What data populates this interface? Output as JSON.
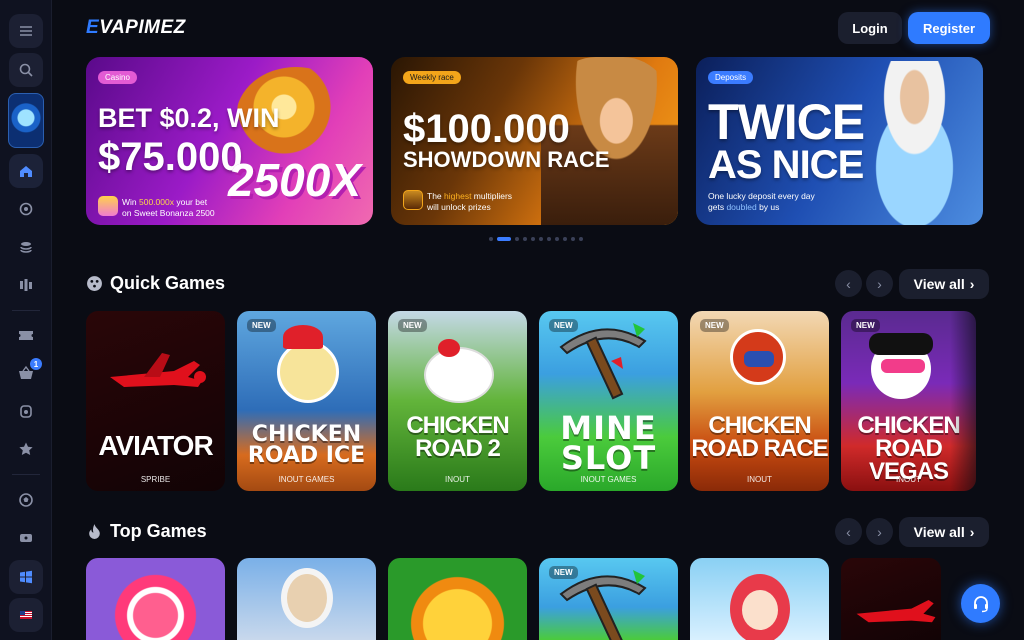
{
  "brand": {
    "logo_prefix": "E",
    "logo_rest": "VAPIMEZ",
    "accent": "#2f7bff"
  },
  "header": {
    "login": "Login",
    "register": "Register"
  },
  "sidebar": {
    "icons": [
      "menu-icon",
      "search-icon",
      "home-icon",
      "casino-chip-icon",
      "stack-icon",
      "live-games-icon",
      "ticket-icon",
      "basket-icon",
      "cup-icon",
      "star-icon",
      "sports-ball-icon",
      "sport-tickets-icon",
      "windows-icon",
      "flag-us-icon"
    ],
    "basket_badge": "1"
  },
  "banners": [
    {
      "tag": "Casino",
      "title1": "BET $0.2, WIN",
      "title2": "$75.000",
      "big": "2500X",
      "desc_pre": "Win ",
      "desc_hl": "500.000x",
      "desc_post": " your bet",
      "desc2": "on Sweet Bonanza 2500"
    },
    {
      "tag": "Weekly race",
      "title1": "$100.000",
      "title2": "SHOWDOWN RACE",
      "desc_pre": "The ",
      "desc_hl": "highest",
      "desc_post": " multipliers",
      "desc2": "will unlock prizes"
    },
    {
      "tag": "Deposits",
      "title1": "TWICE",
      "title2": "AS NICE",
      "desc1": "One lucky deposit every day",
      "desc_pre": "gets ",
      "desc_hl": "doubled",
      "desc_post": " by us"
    }
  ],
  "carousel": {
    "active_index": 1,
    "count": 11
  },
  "quick_games": {
    "title": "Quick Games",
    "view_all": "View all",
    "games": [
      {
        "name": "AVIATOR",
        "provider": "SPRIBE",
        "new": ""
      },
      {
        "name_line1": "CHICKEN",
        "name_line2": "ROAD ICE",
        "provider": "INOUT GAMES",
        "new": "NEW"
      },
      {
        "name_line1": "CHICKEN",
        "name_line2": "ROAD 2",
        "provider": "INOUT",
        "new": "NEW"
      },
      {
        "name_line1": "MINE",
        "name_line2": "SLOT",
        "provider": "INOUT GAMES",
        "new": "NEW"
      },
      {
        "name_line1": "CHICKEN",
        "name_line2": "ROAD RACE",
        "provider": "INOUT",
        "new": "NEW"
      },
      {
        "name_line1": "CHICKEN",
        "name_line2": "ROAD VEGAS",
        "provider": "INOUT",
        "new": "NEW"
      }
    ]
  },
  "top_games": {
    "title": "Top Games",
    "view_all": "View all",
    "new_badge": "NEW"
  }
}
